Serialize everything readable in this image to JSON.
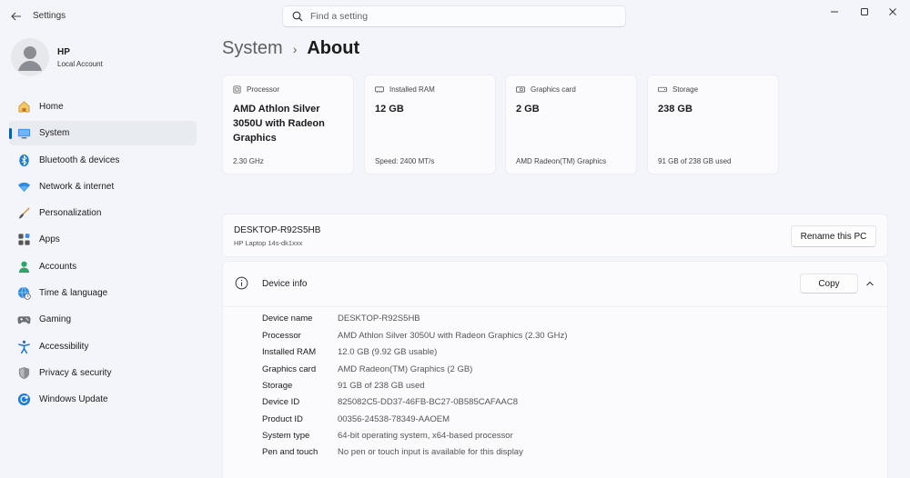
{
  "window": {
    "title": "Settings",
    "search_placeholder": "Find a setting",
    "controls": [
      "minimize-icon",
      "maximize-icon",
      "close-icon"
    ]
  },
  "profile": {
    "name": "HP",
    "account_type": "Local Account"
  },
  "sidebar": {
    "items": [
      {
        "label": "Home",
        "icon": "home-icon"
      },
      {
        "label": "System",
        "icon": "system-icon",
        "active": true
      },
      {
        "label": "Bluetooth & devices",
        "icon": "bluetooth-icon"
      },
      {
        "label": "Network & internet",
        "icon": "wifi-icon"
      },
      {
        "label": "Personalization",
        "icon": "brush-icon"
      },
      {
        "label": "Apps",
        "icon": "apps-icon"
      },
      {
        "label": "Accounts",
        "icon": "accounts-icon"
      },
      {
        "label": "Time & language",
        "icon": "globe-clock-icon"
      },
      {
        "label": "Gaming",
        "icon": "gamepad-icon"
      },
      {
        "label": "Accessibility",
        "icon": "accessibility-icon"
      },
      {
        "label": "Privacy & security",
        "icon": "shield-icon"
      },
      {
        "label": "Windows Update",
        "icon": "update-icon"
      }
    ]
  },
  "header": {
    "breadcrumb_parent": "System",
    "separator": "›",
    "breadcrumb_current": "About"
  },
  "spec_cards": [
    {
      "label": "Processor",
      "value": "AMD Athlon Silver 3050U with Radeon Graphics",
      "sub": "2.30 GHz",
      "icon": "processor-icon"
    },
    {
      "label": "Installed RAM",
      "value": "12 GB",
      "sub": "Speed: 2400 MT/s",
      "icon": "ram-icon"
    },
    {
      "label": "Graphics card",
      "value": "2 GB",
      "sub": "AMD Radeon(TM) Graphics",
      "icon": "graphics-card-icon"
    },
    {
      "label": "Storage",
      "value": "238 GB",
      "sub": "91 GB of 238 GB used",
      "icon": "storage-icon"
    }
  ],
  "pc": {
    "name": "DESKTOP-R92S5HB",
    "model": "HP Laptop 14s-dk1xxx",
    "rename_label": "Rename this PC"
  },
  "device_info": {
    "title": "Device info",
    "copy_label": "Copy",
    "rows": [
      {
        "key": "Device name",
        "value": "DESKTOP-R92S5HB"
      },
      {
        "key": "Processor",
        "value": "AMD Athlon Silver 3050U with Radeon Graphics (2.30 GHz)"
      },
      {
        "key": "Installed RAM",
        "value": "12.0 GB (9.92 GB usable)"
      },
      {
        "key": "Graphics card",
        "value": "AMD Radeon(TM) Graphics (2 GB)"
      },
      {
        "key": "Storage",
        "value": "91 GB of 238 GB used"
      },
      {
        "key": "Device ID",
        "value": "825082C5-DD37-46FB-BC27-0B585CAFAAC8"
      },
      {
        "key": "Product ID",
        "value": "00356-24538-78349-AAOEM"
      },
      {
        "key": "System type",
        "value": "64-bit operating system, x64-based processor"
      },
      {
        "key": "Pen and touch",
        "value": "No pen or touch input is available for this display"
      }
    ]
  },
  "colors": {
    "accent": "#005fb8",
    "background": "#f3f5fa",
    "card": "#fbfbfd"
  }
}
